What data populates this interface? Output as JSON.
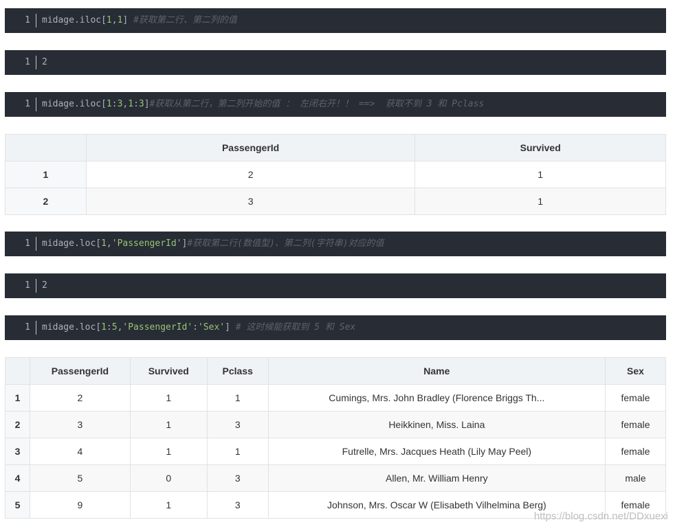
{
  "blocks": [
    {
      "line_no": "1",
      "tokens": [
        {
          "t": "plain",
          "v": "midage.iloc["
        },
        {
          "t": "num",
          "v": "1"
        },
        {
          "t": "plain",
          "v": ","
        },
        {
          "t": "num",
          "v": "1"
        },
        {
          "t": "plain",
          "v": "] "
        },
        {
          "t": "com",
          "v": "#获取第二行、第二列的值"
        }
      ]
    },
    {
      "line_no": "1",
      "tokens": [
        {
          "t": "plain",
          "v": "2"
        }
      ]
    },
    {
      "line_no": "1",
      "tokens": [
        {
          "t": "plain",
          "v": "midage.iloc["
        },
        {
          "t": "num",
          "v": "1"
        },
        {
          "t": "plain",
          "v": ":"
        },
        {
          "t": "num",
          "v": "3"
        },
        {
          "t": "plain",
          "v": ","
        },
        {
          "t": "num",
          "v": "1"
        },
        {
          "t": "plain",
          "v": ":"
        },
        {
          "t": "num",
          "v": "3"
        },
        {
          "t": "plain",
          "v": "]"
        },
        {
          "t": "com",
          "v": "#获取从第二行，第二列开始的值 ： 左闭右开！！ ==>  获取不到 3 和 Pclass"
        }
      ]
    },
    {
      "line_no": "1",
      "tokens": [
        {
          "t": "plain",
          "v": "midage.loc["
        },
        {
          "t": "num",
          "v": "1"
        },
        {
          "t": "plain",
          "v": ","
        },
        {
          "t": "str",
          "v": "'PassengerId'"
        },
        {
          "t": "plain",
          "v": "]"
        },
        {
          "t": "com",
          "v": "#获取第二行(数值型)、第二列(字符串)对应的值"
        }
      ]
    },
    {
      "line_no": "1",
      "tokens": [
        {
          "t": "plain",
          "v": "2"
        }
      ]
    },
    {
      "line_no": "1",
      "tokens": [
        {
          "t": "plain",
          "v": "midage.loc["
        },
        {
          "t": "num",
          "v": "1"
        },
        {
          "t": "plain",
          "v": ":"
        },
        {
          "t": "num",
          "v": "5"
        },
        {
          "t": "plain",
          "v": ","
        },
        {
          "t": "str",
          "v": "'PassengerId'"
        },
        {
          "t": "plain",
          "v": ":"
        },
        {
          "t": "str",
          "v": "'Sex'"
        },
        {
          "t": "plain",
          "v": "] "
        },
        {
          "t": "com",
          "v": "# 这时候能获取到 5 和 Sex"
        }
      ]
    }
  ],
  "table1": {
    "headers": [
      "",
      "PassengerId",
      "Survived"
    ],
    "rows": [
      [
        "1",
        "2",
        "1"
      ],
      [
        "2",
        "3",
        "1"
      ]
    ]
  },
  "table2": {
    "headers": [
      "",
      "PassengerId",
      "Survived",
      "Pclass",
      "Name",
      "Sex"
    ],
    "rows": [
      [
        "1",
        "2",
        "1",
        "1",
        "Cumings, Mrs. John Bradley (Florence Briggs Th...",
        "female"
      ],
      [
        "2",
        "3",
        "1",
        "3",
        "Heikkinen, Miss. Laina",
        "female"
      ],
      [
        "3",
        "4",
        "1",
        "1",
        "Futrelle, Mrs. Jacques Heath (Lily May Peel)",
        "female"
      ],
      [
        "4",
        "5",
        "0",
        "3",
        "Allen, Mr. William Henry",
        "male"
      ],
      [
        "5",
        "9",
        "1",
        "3",
        "Johnson, Mrs. Oscar W (Elisabeth Vilhelmina Berg)",
        "female"
      ]
    ]
  },
  "watermark": "https://blog.csdn.net/DDxuexi"
}
